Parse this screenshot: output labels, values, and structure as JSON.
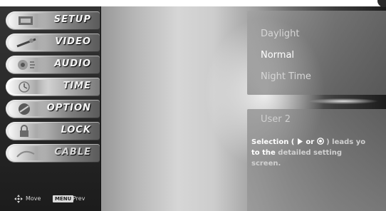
{
  "menu": {
    "items": [
      {
        "id": "setup",
        "label": "SETUP",
        "icon": "setup-icon"
      },
      {
        "id": "video",
        "label": "VIDEO",
        "icon": "video-icon"
      },
      {
        "id": "audio",
        "label": "AUDIO",
        "icon": "audio-icon"
      },
      {
        "id": "time",
        "label": "TIME",
        "icon": "clock-icon"
      },
      {
        "id": "option",
        "label": "OPTION",
        "icon": "option-icon"
      },
      {
        "id": "lock",
        "label": "LOCK",
        "icon": "lock-icon"
      },
      {
        "id": "cable",
        "label": "CABLE",
        "icon": "cable-icon"
      }
    ],
    "selected": "time"
  },
  "hints": {
    "move_label": "Move",
    "menu_key": "MENU",
    "prev_label": "Prev"
  },
  "options": {
    "items": [
      "Daylight",
      "Normal",
      "Night Time"
    ],
    "highlighted": "Normal"
  },
  "user": {
    "title": "User 2"
  },
  "help": {
    "line1_a": "Selection (",
    "line1_or": " or ",
    "line1_b": ") leads yo",
    "line2_a": "to the ",
    "line2_b": "detailed setting",
    "line3": "screen."
  },
  "colors": {
    "menu_label": "#f4f4f4",
    "highlight_text": "#ffffff",
    "dim_text": "#d6d6d6"
  }
}
